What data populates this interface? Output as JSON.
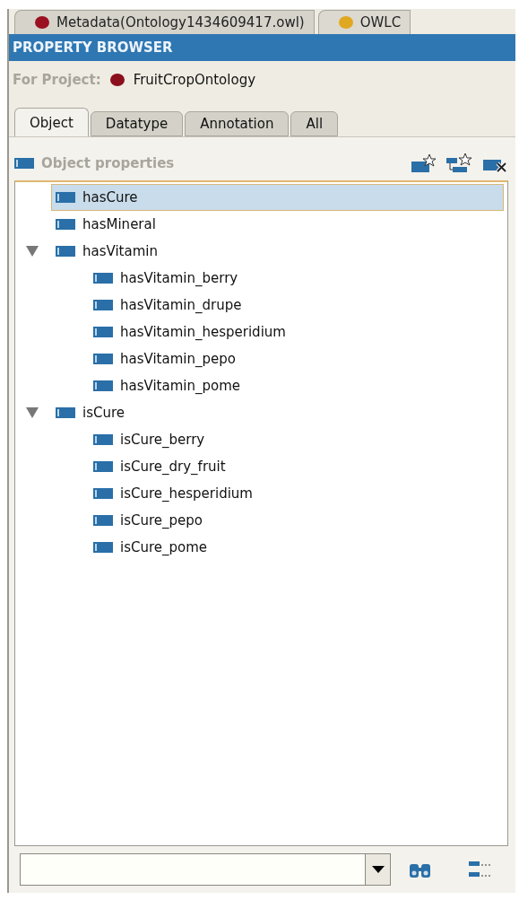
{
  "editor_tabs": [
    {
      "label": "Metadata(Ontology1434609417.owl)",
      "color": "#9b1020"
    },
    {
      "label": "OWLC",
      "color": "#e0a820"
    }
  ],
  "header": {
    "title": "PROPERTY BROWSER"
  },
  "project": {
    "label": "For Project:",
    "name": "FruitCropOntology"
  },
  "tabs": [
    {
      "label": "Object",
      "selected": true
    },
    {
      "label": "Datatype",
      "selected": false
    },
    {
      "label": "Annotation",
      "selected": false
    },
    {
      "label": "All",
      "selected": false
    }
  ],
  "tree": {
    "title": "Object properties",
    "items": [
      {
        "label": "hasCure",
        "selected": true
      },
      {
        "label": "hasMineral",
        "selected": false
      },
      {
        "label": "hasVitamin",
        "selected": false,
        "expanded": true,
        "children": [
          {
            "label": "hasVitamin_berry",
            "selected": false
          },
          {
            "label": "hasVitamin_drupe",
            "selected": false
          },
          {
            "label": "hasVitamin_hesperidium",
            "selected": false
          },
          {
            "label": "hasVitamin_pepo",
            "selected": false
          },
          {
            "label": "hasVitamin_pome",
            "selected": false
          }
        ]
      },
      {
        "label": "isCure",
        "selected": false,
        "expanded": true,
        "children": [
          {
            "label": "isCure_berry",
            "selected": false
          },
          {
            "label": "isCure_dry_fruit",
            "selected": false
          },
          {
            "label": "isCure_hesperidium",
            "selected": false
          },
          {
            "label": "isCure_pepo",
            "selected": false
          },
          {
            "label": "isCure_pome",
            "selected": false
          }
        ]
      }
    ]
  }
}
